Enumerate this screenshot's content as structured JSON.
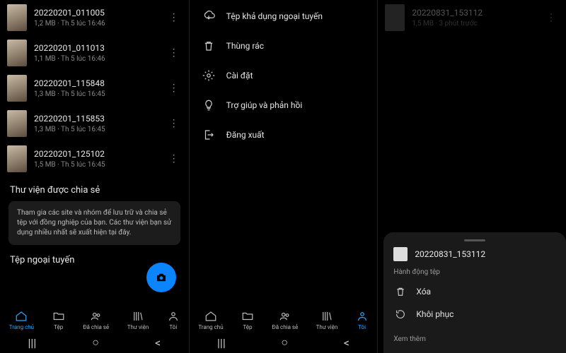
{
  "panel1": {
    "files": [
      {
        "name": "20220201_011005",
        "meta": "1,2 MB · Th 5 lúc 16:46"
      },
      {
        "name": "20220201_011013",
        "meta": "1,1 MB · Th 5 lúc 16:46"
      },
      {
        "name": "20220201_115848",
        "meta": "1,3 MB · Th 5 lúc 16:45"
      },
      {
        "name": "20220201_115853",
        "meta": "1,3 MB · Th 5 lúc 16:45"
      },
      {
        "name": "20220201_125102",
        "meta": "1,5 MB · Th 5 lúc 16:45"
      }
    ],
    "shared_title": "Thư viện được chia sẻ",
    "shared_tip": "Tham gia các site và nhóm để lưu trữ và chia sẻ tệp với đồng nghiệp của bạn. Các thư viện bạn sử dụng nhiều nhất sẽ xuất hiện tại đây.",
    "offline_title": "Tệp ngoại tuyến"
  },
  "tabs": {
    "items": [
      {
        "label": "Trang chủ",
        "icon": "home"
      },
      {
        "label": "Tệp",
        "icon": "folder"
      },
      {
        "label": "Đã chia sẻ",
        "icon": "people"
      },
      {
        "label": "Thư viện",
        "icon": "library"
      },
      {
        "label": "Tôi",
        "icon": "person"
      }
    ],
    "active_left": 0,
    "active_mid": 4
  },
  "panel2": {
    "menu": [
      {
        "label": "Tệp khả dụng ngoại tuyến",
        "icon": "offline"
      },
      {
        "label": "Thùng rác",
        "icon": "trash"
      },
      {
        "label": "Cài đặt",
        "icon": "gear"
      },
      {
        "label": "Trợ giúp và phản hồi",
        "icon": "bulb"
      },
      {
        "label": "Đăng xuất",
        "icon": "logout"
      }
    ]
  },
  "panel3": {
    "faint_file": {
      "name": "20220831_153112",
      "meta": "1,5 MB · 3 phút trước"
    },
    "sheet": {
      "title": "20220831_153112",
      "section1": "Hành động tệp",
      "actions": [
        {
          "label": "Xóa",
          "icon": "trash"
        },
        {
          "label": "Khôi phục",
          "icon": "restore"
        }
      ],
      "section2": "Xem thêm"
    }
  }
}
